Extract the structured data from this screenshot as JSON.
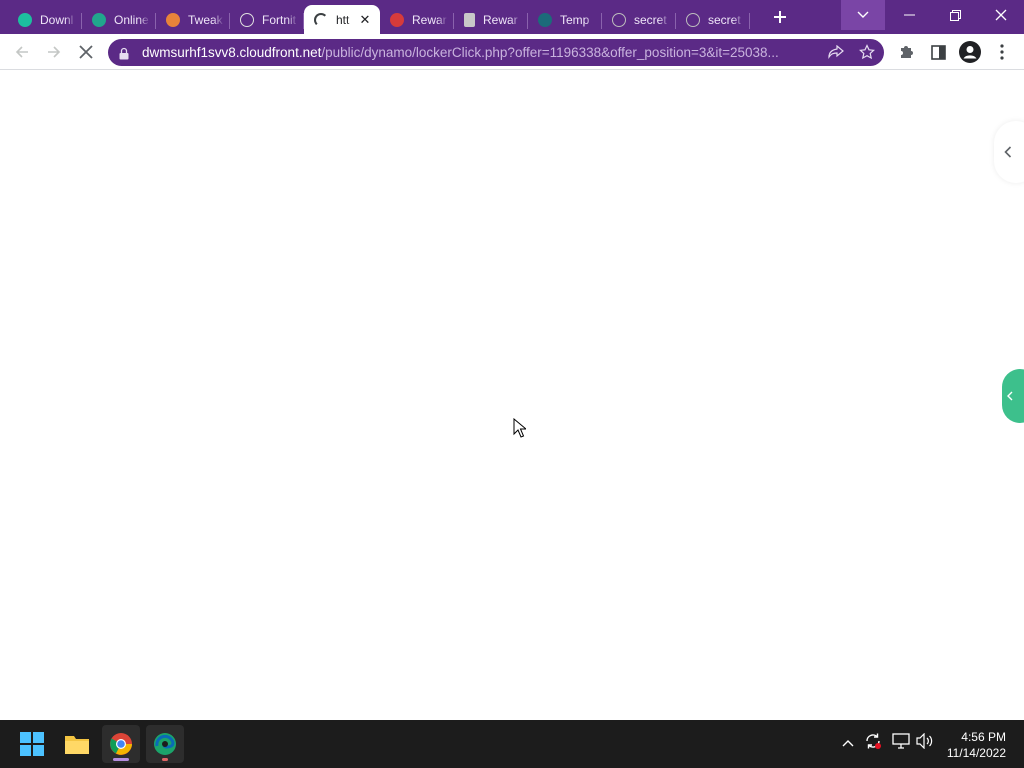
{
  "browser": {
    "tabs": [
      {
        "title": "Downl",
        "icon": "gem-icon",
        "color": "#1dbf9f"
      },
      {
        "title": "Online",
        "icon": "green-circle-icon",
        "color": "#21a68d"
      },
      {
        "title": "Tweak",
        "icon": "tweak-icon",
        "color": "#e8833a"
      },
      {
        "title": "Fortnit",
        "icon": "globe-icon",
        "color": "#e0e0e0"
      },
      {
        "title": "htt",
        "icon": "loading-spinner-icon",
        "active": true
      },
      {
        "title": "Rewar",
        "icon": "red-bell-icon",
        "color": "#d63b3b"
      },
      {
        "title": "Rewar",
        "icon": "document-icon",
        "color": "#c8c8c8"
      },
      {
        "title": "Temp",
        "icon": "teal-circle-icon",
        "color": "#1c6b7a"
      },
      {
        "title": "secret",
        "icon": "globe-icon",
        "color": "#bdbdbd"
      },
      {
        "title": "secret",
        "icon": "globe-icon",
        "color": "#bdbdbd"
      }
    ],
    "url_host": "dwmsurhf1svv8.cloudfront.net",
    "url_path": "/public/dynamo/lockerClick.php?offer=1196338&offer_position=3&it=25038..."
  },
  "taskbar": {
    "time": "4:56 PM",
    "date": "11/14/2022"
  },
  "colors": {
    "frame": "#5b2a86",
    "accent_green": "#3dc08c"
  }
}
